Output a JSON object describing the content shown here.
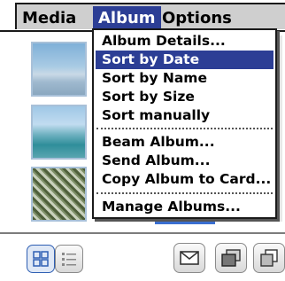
{
  "menubar": {
    "titles": [
      "Media",
      "Album",
      "Options"
    ],
    "active": "Album"
  },
  "album_menu": {
    "group1": [
      "Album Details...",
      "Sort by Date",
      "Sort by Name",
      "Sort by Size",
      "Sort manually"
    ],
    "group2": [
      "Beam Album...",
      "Send Album...",
      "Copy Album to Card..."
    ],
    "group3": [
      "Manage Albums..."
    ],
    "selected_item": "Sort by Date"
  },
  "toolbar": {
    "icons": [
      "thumbnail-view-icon",
      "list-view-icon",
      "mail-icon",
      "album-icon",
      "copy-icon"
    ]
  },
  "colors": {
    "highlight": "#2c3e95",
    "menubar_bg": "#cfcfcf"
  }
}
